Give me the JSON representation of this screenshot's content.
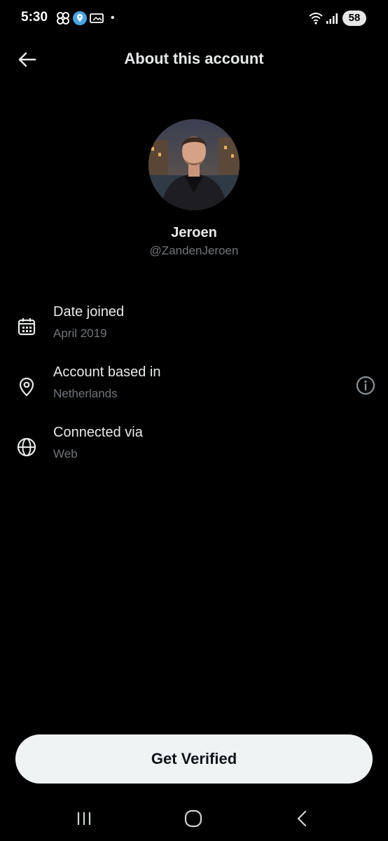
{
  "status_bar": {
    "time": "5:30",
    "dot": "•",
    "battery": "58",
    "icons": [
      "pinwheel-icon",
      "location-badge-icon",
      "cast-icon",
      "wifi-icon",
      "signal-icon"
    ]
  },
  "header": {
    "title": "About this account",
    "back_icon": "arrow-left-icon"
  },
  "profile": {
    "name": "Jeroen",
    "handle": "@ZandenJeroen"
  },
  "info_rows": [
    {
      "title": "Date joined",
      "value": "April 2019",
      "icon": "calendar-icon"
    },
    {
      "title": "Account based in",
      "value": "Netherlands",
      "icon": "location-pin-icon",
      "trailing_icon": "info-icon"
    },
    {
      "title": "Connected via",
      "value": "Web",
      "icon": "globe-icon"
    }
  ],
  "cta": {
    "label": "Get Verified"
  },
  "nav_bar": {
    "buttons": [
      "recent-apps-icon",
      "home-icon",
      "back-icon"
    ]
  },
  "colors": {
    "background": "#000000",
    "primary_text": "#e7e9ea",
    "secondary_text": "#71767b",
    "cta_background": "#eff3f4",
    "cta_text": "#0f1419"
  }
}
